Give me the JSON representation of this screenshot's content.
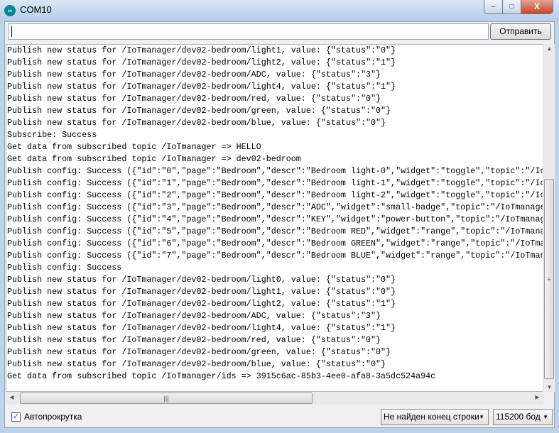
{
  "window": {
    "title": "COM10",
    "icon": "arduino-icon",
    "minimize": "–",
    "maximize": "□",
    "close": "X"
  },
  "toolbar": {
    "input_value": "",
    "send_label": "Отправить"
  },
  "console": {
    "lines": [
      "Publish new status for /IoTmanager/dev02-bedroom/light1, value: {\"status\":\"0\"}",
      "Publish new status for /IoTmanager/dev02-bedroom/light2, value: {\"status\":\"1\"}",
      "Publish new status for /IoTmanager/dev02-bedroom/ADC, value: {\"status\":\"3\"}",
      "Publish new status for /IoTmanager/dev02-bedroom/light4, value: {\"status\":\"1\"}",
      "Publish new status for /IoTmanager/dev02-bedroom/red, value: {\"status\":\"0\"}",
      "Publish new status for /IoTmanager/dev02-bedroom/green, value: {\"status\":\"0\"}",
      "Publish new status for /IoTmanager/dev02-bedroom/blue, value: {\"status\":\"0\"}",
      "Subscribe: Success",
      "Get data from subscribed topic /IoTmanager => HELLO",
      "Get data from subscribed topic /IoTmanager => dev02-bedroom",
      "Publish config: Success ({\"id\":\"0\",\"page\":\"Bedroom\",\"descr\":\"Bedroom light-0\",\"widget\":\"toggle\",\"topic\":\"/Io",
      "Publish config: Success ({\"id\":\"1\",\"page\":\"Bedroom\",\"descr\":\"Bedroom light-1\",\"widget\":\"toggle\",\"topic\":\"/Io",
      "Publish config: Success ({\"id\":\"2\",\"page\":\"Bedroom\",\"descr\":\"Bedroom light-2\",\"widget\":\"toggle\",\"topic\":\"/Io",
      "Publish config: Success ({\"id\":\"3\",\"page\":\"Bedroom\",\"descr\":\"ADC\",\"widget\":\"small-badge\",\"topic\":\"/IoTmanage",
      "Publish config: Success ({\"id\":\"4\",\"page\":\"Bedroom\",\"descr\":\"KEY\",\"widget\":\"power-button\",\"topic\":\"/IoTmanag",
      "Publish config: Success ({\"id\":\"5\",\"page\":\"Bedroom\",\"descr\":\"Bedroom RED\",\"widget\":\"range\",\"topic\":\"/IoTmana",
      "Publish config: Success ({\"id\":\"6\",\"page\":\"Bedroom\",\"descr\":\"Bedroom GREEN\",\"widget\":\"range\",\"topic\":\"/IoTma",
      "Publish config: Success ({\"id\":\"7\",\"page\":\"Bedroom\",\"descr\":\"Bedroom BLUE\",\"widget\":\"range\",\"topic\":\"/IoTman",
      "Publish config: Success",
      "Publish new status for /IoTmanager/dev02-bedroom/light0, value: {\"status\":\"0\"}",
      "Publish new status for /IoTmanager/dev02-bedroom/light1, value: {\"status\":\"0\"}",
      "Publish new status for /IoTmanager/dev02-bedroom/light2, value: {\"status\":\"1\"}",
      "Publish new status for /IoTmanager/dev02-bedroom/ADC, value: {\"status\":\"3\"}",
      "Publish new status for /IoTmanager/dev02-bedroom/light4, value: {\"status\":\"1\"}",
      "Publish new status for /IoTmanager/dev02-bedroom/red, value: {\"status\":\"0\"}",
      "Publish new status for /IoTmanager/dev02-bedroom/green, value: {\"status\":\"0\"}",
      "Publish new status for /IoTmanager/dev02-bedroom/blue, value: {\"status\":\"0\"}",
      "Get data from subscribed topic /IoTmanager/ids => 3915c6ac-85b3-4ee0-afa8-3a5dc524a94c"
    ]
  },
  "footer": {
    "autoscroll_label": "Автопрокрутка",
    "autoscroll_checked": true,
    "line_ending": "Не найден конец строки",
    "baud": "115200 бод"
  }
}
